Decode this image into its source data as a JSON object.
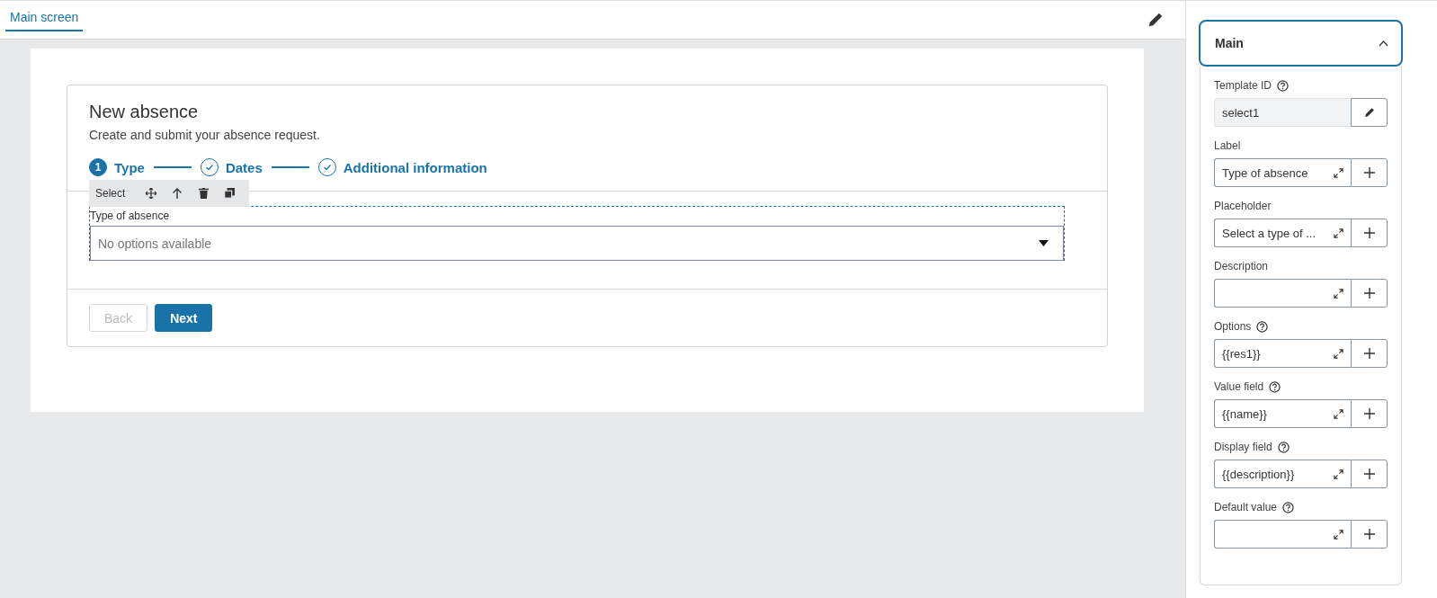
{
  "tabs": [
    {
      "label": "Main screen",
      "selected": true
    }
  ],
  "form": {
    "title": "New absence",
    "subtitle": "Create and submit your absence request.",
    "steps": [
      {
        "number": "1",
        "label": "Type",
        "done": false
      },
      {
        "label": "Dates",
        "done": true
      },
      {
        "label": "Additional information",
        "done": true
      }
    ],
    "toolbar": {
      "label": "Select"
    },
    "select": {
      "label": "Type of absence",
      "placeholder": "No options available"
    },
    "buttons": [
      {
        "label": "Back",
        "kind": "secondary",
        "disabled": true
      },
      {
        "label": "Next",
        "kind": "primary",
        "disabled": false
      }
    ]
  },
  "panel": {
    "title": "Main",
    "expanded": true,
    "fields": [
      {
        "label": "Template ID",
        "help": true,
        "kind": "locked",
        "value": "select1"
      },
      {
        "label": "Label",
        "help": false,
        "kind": "expression",
        "value": "Type of absence"
      },
      {
        "label": "Placeholder",
        "help": false,
        "kind": "expression",
        "value": "Select a type of ..."
      },
      {
        "label": "Description",
        "help": false,
        "kind": "expression"
      },
      {
        "label": "Options",
        "help": true,
        "kind": "expression",
        "value": "{{res1}}"
      },
      {
        "label": "Value field",
        "help": true,
        "kind": "expression",
        "value": "{{name}}"
      },
      {
        "label": "Display field",
        "help": true,
        "kind": "expression",
        "value": "{{description}}"
      },
      {
        "label": "Default value",
        "help": true,
        "kind": "expression"
      }
    ]
  }
}
